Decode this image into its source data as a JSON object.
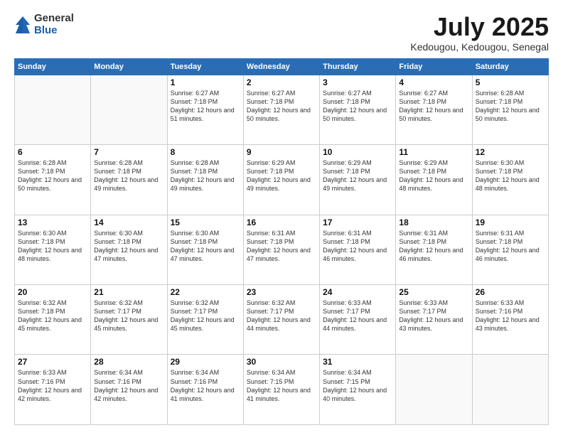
{
  "logo": {
    "general": "General",
    "blue": "Blue"
  },
  "title": "July 2025",
  "subtitle": "Kedougou, Kedougou, Senegal",
  "days_of_week": [
    "Sunday",
    "Monday",
    "Tuesday",
    "Wednesday",
    "Thursday",
    "Friday",
    "Saturday"
  ],
  "weeks": [
    [
      {
        "day": "",
        "info": ""
      },
      {
        "day": "",
        "info": ""
      },
      {
        "day": "1",
        "info": "Sunrise: 6:27 AM\nSunset: 7:18 PM\nDaylight: 12 hours and 51 minutes."
      },
      {
        "day": "2",
        "info": "Sunrise: 6:27 AM\nSunset: 7:18 PM\nDaylight: 12 hours and 50 minutes."
      },
      {
        "day": "3",
        "info": "Sunrise: 6:27 AM\nSunset: 7:18 PM\nDaylight: 12 hours and 50 minutes."
      },
      {
        "day": "4",
        "info": "Sunrise: 6:27 AM\nSunset: 7:18 PM\nDaylight: 12 hours and 50 minutes."
      },
      {
        "day": "5",
        "info": "Sunrise: 6:28 AM\nSunset: 7:18 PM\nDaylight: 12 hours and 50 minutes."
      }
    ],
    [
      {
        "day": "6",
        "info": "Sunrise: 6:28 AM\nSunset: 7:18 PM\nDaylight: 12 hours and 50 minutes."
      },
      {
        "day": "7",
        "info": "Sunrise: 6:28 AM\nSunset: 7:18 PM\nDaylight: 12 hours and 49 minutes."
      },
      {
        "day": "8",
        "info": "Sunrise: 6:28 AM\nSunset: 7:18 PM\nDaylight: 12 hours and 49 minutes."
      },
      {
        "day": "9",
        "info": "Sunrise: 6:29 AM\nSunset: 7:18 PM\nDaylight: 12 hours and 49 minutes."
      },
      {
        "day": "10",
        "info": "Sunrise: 6:29 AM\nSunset: 7:18 PM\nDaylight: 12 hours and 49 minutes."
      },
      {
        "day": "11",
        "info": "Sunrise: 6:29 AM\nSunset: 7:18 PM\nDaylight: 12 hours and 48 minutes."
      },
      {
        "day": "12",
        "info": "Sunrise: 6:30 AM\nSunset: 7:18 PM\nDaylight: 12 hours and 48 minutes."
      }
    ],
    [
      {
        "day": "13",
        "info": "Sunrise: 6:30 AM\nSunset: 7:18 PM\nDaylight: 12 hours and 48 minutes."
      },
      {
        "day": "14",
        "info": "Sunrise: 6:30 AM\nSunset: 7:18 PM\nDaylight: 12 hours and 47 minutes."
      },
      {
        "day": "15",
        "info": "Sunrise: 6:30 AM\nSunset: 7:18 PM\nDaylight: 12 hours and 47 minutes."
      },
      {
        "day": "16",
        "info": "Sunrise: 6:31 AM\nSunset: 7:18 PM\nDaylight: 12 hours and 47 minutes."
      },
      {
        "day": "17",
        "info": "Sunrise: 6:31 AM\nSunset: 7:18 PM\nDaylight: 12 hours and 46 minutes."
      },
      {
        "day": "18",
        "info": "Sunrise: 6:31 AM\nSunset: 7:18 PM\nDaylight: 12 hours and 46 minutes."
      },
      {
        "day": "19",
        "info": "Sunrise: 6:31 AM\nSunset: 7:18 PM\nDaylight: 12 hours and 46 minutes."
      }
    ],
    [
      {
        "day": "20",
        "info": "Sunrise: 6:32 AM\nSunset: 7:18 PM\nDaylight: 12 hours and 45 minutes."
      },
      {
        "day": "21",
        "info": "Sunrise: 6:32 AM\nSunset: 7:17 PM\nDaylight: 12 hours and 45 minutes."
      },
      {
        "day": "22",
        "info": "Sunrise: 6:32 AM\nSunset: 7:17 PM\nDaylight: 12 hours and 45 minutes."
      },
      {
        "day": "23",
        "info": "Sunrise: 6:32 AM\nSunset: 7:17 PM\nDaylight: 12 hours and 44 minutes."
      },
      {
        "day": "24",
        "info": "Sunrise: 6:33 AM\nSunset: 7:17 PM\nDaylight: 12 hours and 44 minutes."
      },
      {
        "day": "25",
        "info": "Sunrise: 6:33 AM\nSunset: 7:17 PM\nDaylight: 12 hours and 43 minutes."
      },
      {
        "day": "26",
        "info": "Sunrise: 6:33 AM\nSunset: 7:16 PM\nDaylight: 12 hours and 43 minutes."
      }
    ],
    [
      {
        "day": "27",
        "info": "Sunrise: 6:33 AM\nSunset: 7:16 PM\nDaylight: 12 hours and 42 minutes."
      },
      {
        "day": "28",
        "info": "Sunrise: 6:34 AM\nSunset: 7:16 PM\nDaylight: 12 hours and 42 minutes."
      },
      {
        "day": "29",
        "info": "Sunrise: 6:34 AM\nSunset: 7:16 PM\nDaylight: 12 hours and 41 minutes."
      },
      {
        "day": "30",
        "info": "Sunrise: 6:34 AM\nSunset: 7:15 PM\nDaylight: 12 hours and 41 minutes."
      },
      {
        "day": "31",
        "info": "Sunrise: 6:34 AM\nSunset: 7:15 PM\nDaylight: 12 hours and 40 minutes."
      },
      {
        "day": "",
        "info": ""
      },
      {
        "day": "",
        "info": ""
      }
    ]
  ]
}
